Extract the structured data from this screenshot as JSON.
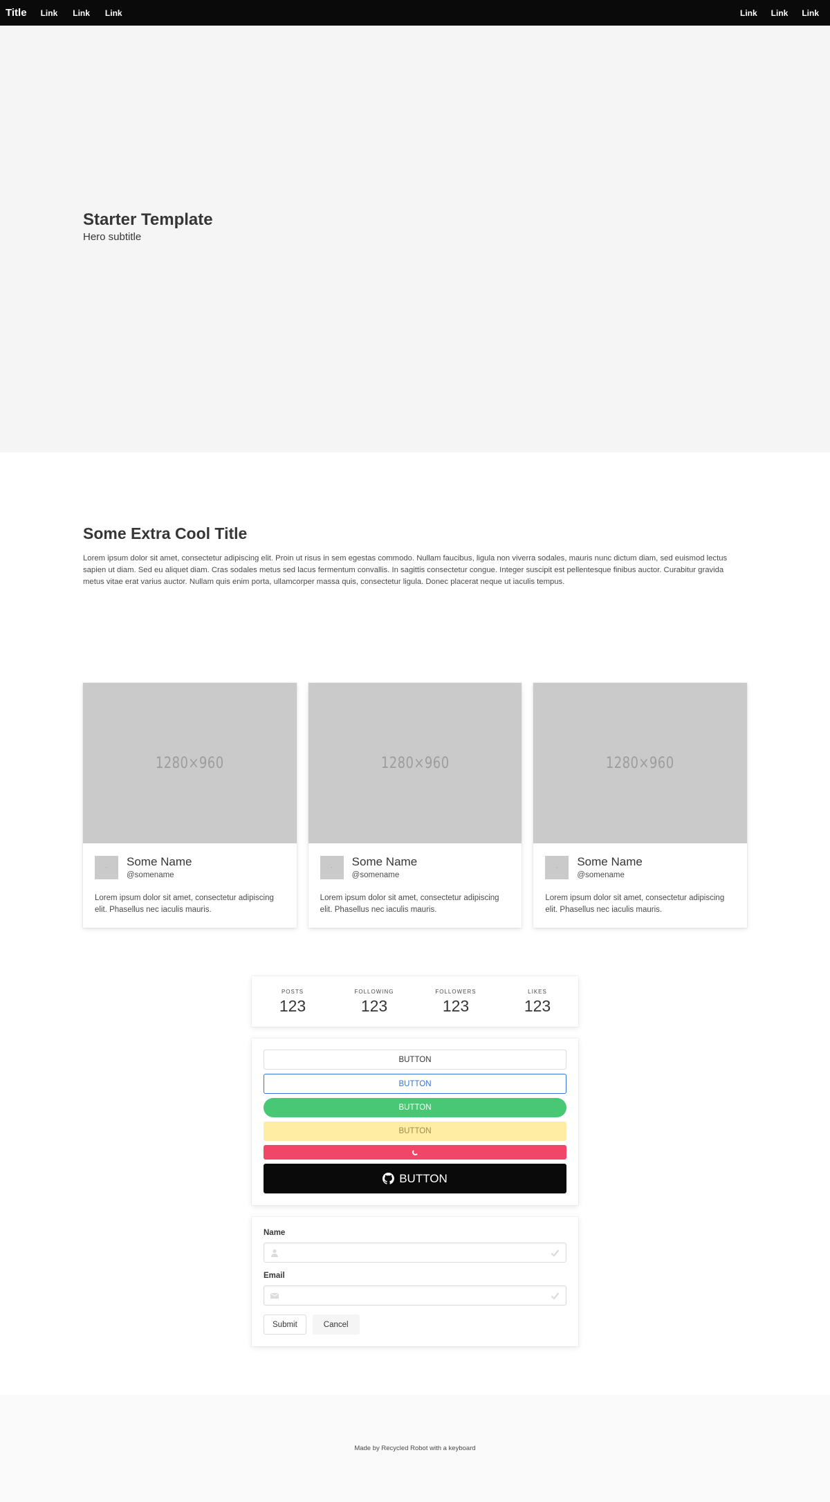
{
  "navbar": {
    "brand": "Title",
    "left_links": [
      "Link",
      "Link",
      "Link"
    ],
    "right_links": [
      "Link",
      "Link",
      "Link"
    ]
  },
  "hero": {
    "title": "Starter Template",
    "subtitle": "Hero subtitle"
  },
  "section": {
    "title": "Some Extra Cool Title",
    "text": "Lorem ipsum dolor sit amet, consectetur adipiscing elit. Proin ut risus in sem egestas commodo. Nullam faucibus, ligula non viverra sodales, mauris nunc dictum diam, sed euismod lectus sapien ut diam. Sed eu aliquet diam. Cras sodales metus sed lacus fermentum convallis. In sagittis consectetur congue. Integer suscipit est pellentesque finibus auctor. Curabitur gravida metus vitae erat varius auctor. Nullam quis enim porta, ullamcorper massa quis, consectetur ligula. Donec placerat neque ut iaculis tempus."
  },
  "cards": [
    {
      "image_label": "1280×960",
      "name": "Some Name",
      "handle": "@somename",
      "text": "Lorem ipsum dolor sit amet, consectetur adipiscing elit. Phasellus nec iaculis mauris."
    },
    {
      "image_label": "1280×960",
      "name": "Some Name",
      "handle": "@somename",
      "text": "Lorem ipsum dolor sit amet, consectetur adipiscing elit. Phasellus nec iaculis mauris."
    },
    {
      "image_label": "1280×960",
      "name": "Some Name",
      "handle": "@somename",
      "text": "Lorem ipsum dolor sit amet, consectetur adipiscing elit. Phasellus nec iaculis mauris."
    }
  ],
  "stats": [
    {
      "label": "POSTS",
      "value": "123"
    },
    {
      "label": "FOLLOWING",
      "value": "123"
    },
    {
      "label": "FOLLOWERS",
      "value": "123"
    },
    {
      "label": "LIKES",
      "value": "123"
    }
  ],
  "buttons": {
    "default": "BUTTON",
    "outline_blue": "BUTTON",
    "green_rounded": "BUTTON",
    "yellow": "BUTTON",
    "dark_github": "BUTTON",
    "icons": {
      "github": "github-icon",
      "loading": "spinner-icon"
    }
  },
  "form": {
    "name_label": "Name",
    "name_value": "",
    "email_label": "Email",
    "email_value": "",
    "submit_label": "Submit",
    "cancel_label": "Cancel",
    "icons": {
      "name": "user-icon",
      "email": "envelope-icon",
      "valid": "check-icon"
    }
  },
  "footer": {
    "text": "Made by Recycled Robot with a keyboard"
  },
  "colors": {
    "navbar_bg": "#0a0a0a",
    "hero_bg": "#f5f5f5",
    "blue": "#3273dc",
    "green": "#48c774",
    "yellow": "#ffeda4",
    "red": "#f14668",
    "dark": "#0a0a0a"
  }
}
